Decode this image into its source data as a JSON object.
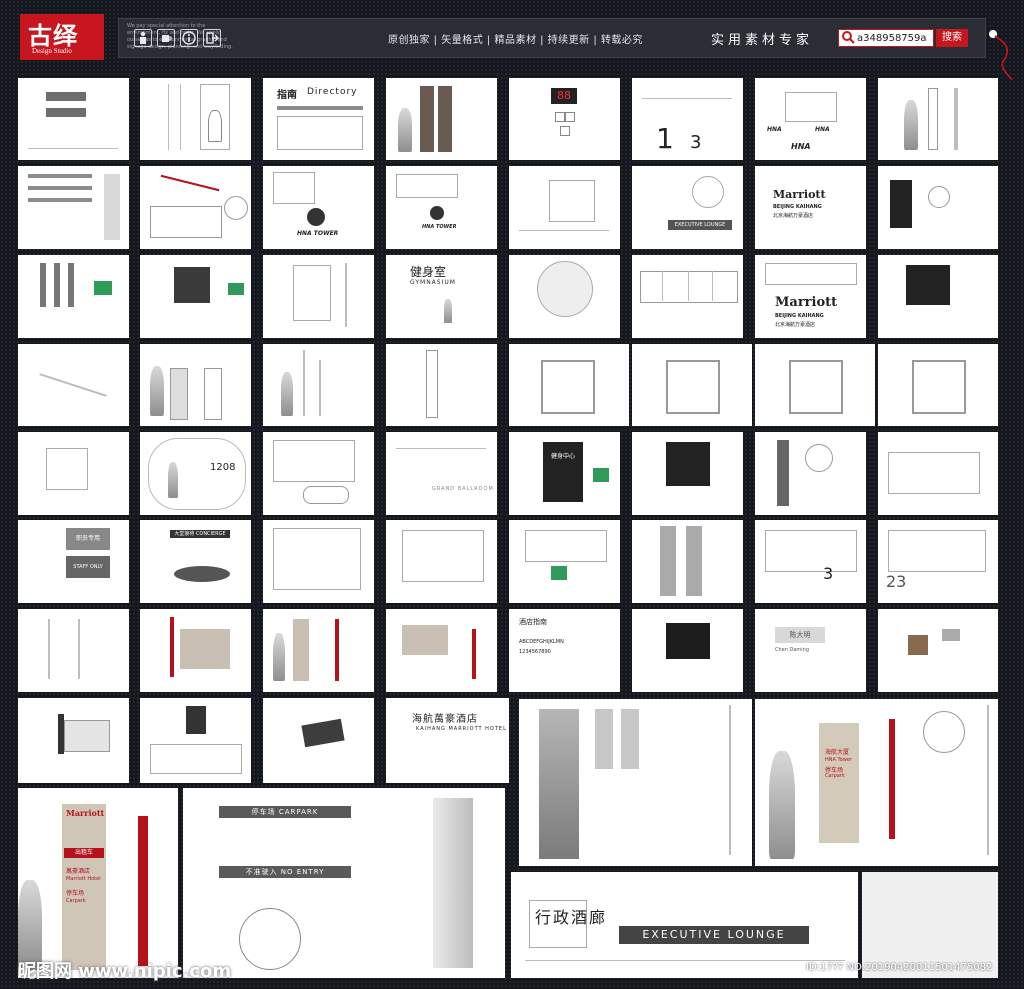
{
  "header": {
    "logo_mark": "古绎",
    "logo_sub": "Design Studio",
    "tagline": "We pay special attention to the environment, fix and order. We apply ourselves to environmental graphic and signage design, planning, and wayfinding.",
    "icons": [
      "person-icon",
      "cup-icon",
      "info-icon",
      "exit-icon"
    ],
    "features": "原创独家 | 矢量格式 | 精品素材 | 持续更新 | 转载必究",
    "expert": "实用素材专家",
    "search_value": "a348958759a",
    "search_button": "搜索"
  },
  "sheets": {
    "directory": {
      "cn": "指南",
      "en": "Directory"
    },
    "elevator_digits": "88",
    "floor_1": "1",
    "floor_3": "3",
    "hna": "HNA",
    "hna_tower": "HNA TOWER",
    "executive_cn": "行政酒廊",
    "executive_en": "EXECUTIVE LOUNGE",
    "marriott_logo": "Marriott",
    "marriott_sub_en": "BEIJING KAIHANG",
    "marriott_sub_cn": "北京海航万豪酒店",
    "gym_cn": "健身室",
    "gym_en": "GYMNASIUM",
    "room_number": "1208",
    "ballroom": "GRAND BALLROOM",
    "fitness_cn": "健身中心",
    "staff_cn": "职员专用",
    "staff_en": "STAFF ONLY",
    "concierge": "大堂接待 CONCIERGE",
    "floor_23": "23",
    "big_3": "3",
    "name_plate_cn": "陈大明",
    "name_plate_en": "Chen Daming",
    "hotel_cn": "海航萬豪酒店",
    "hotel_en": "KAIHANG MARRIOTT HOTEL",
    "font_sample_cn": "酒店指南",
    "font_sample_en": "ABCDEFGHIJKLMN",
    "font_sample_num": "1234567890",
    "carpark": "停车场 CARPARK",
    "no_entry": "不准驶入 NO ENTRY",
    "taxi": "出租车",
    "marriott_hotel_cn": "萬豪酒店",
    "marriott_hotel_en": "Marriott Hotel",
    "carpark_cn": "停车场",
    "carpark_en": "Carpark",
    "hna_tower_cn": "海航大厦",
    "hna_tower_en": "HNA Tower"
  },
  "watermark": {
    "site": "昵图网 www.nipic.com",
    "id_text": "ID:17??     NO:20190420011501475082"
  }
}
